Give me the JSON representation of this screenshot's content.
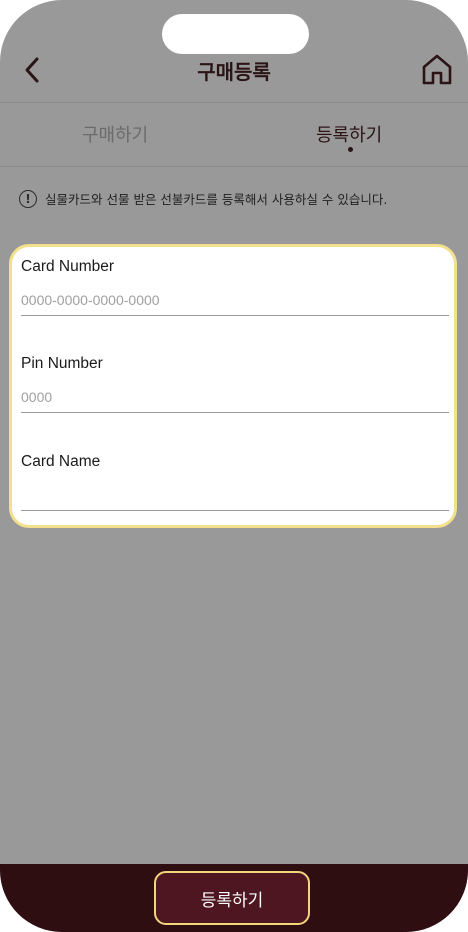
{
  "header": {
    "title": "구매등록",
    "back_icon": "chevron-left-icon",
    "home_icon": "home-icon"
  },
  "tabs": [
    {
      "label": "구매하기",
      "active": false
    },
    {
      "label": "등록하기",
      "active": true
    }
  ],
  "notice": {
    "icon": "exclamation-circle-icon",
    "text": "실물카드와 선물 받은 선불카드를 등록해서 사용하실 수 있습니다."
  },
  "form": {
    "fields": [
      {
        "label": "Card Number",
        "placeholder": "0000-0000-0000-0000",
        "value": ""
      },
      {
        "label": "Pin Number",
        "placeholder": "0000",
        "value": ""
      },
      {
        "label": "Card Name",
        "placeholder": "",
        "value": ""
      }
    ]
  },
  "footer": {
    "register_label": "등록하기"
  },
  "colors": {
    "background": "#999999",
    "bottom_bar": "#2f0e12",
    "button": "#4d1620",
    "highlight_border": "#f2e08c",
    "title_text": "#2a1416"
  }
}
